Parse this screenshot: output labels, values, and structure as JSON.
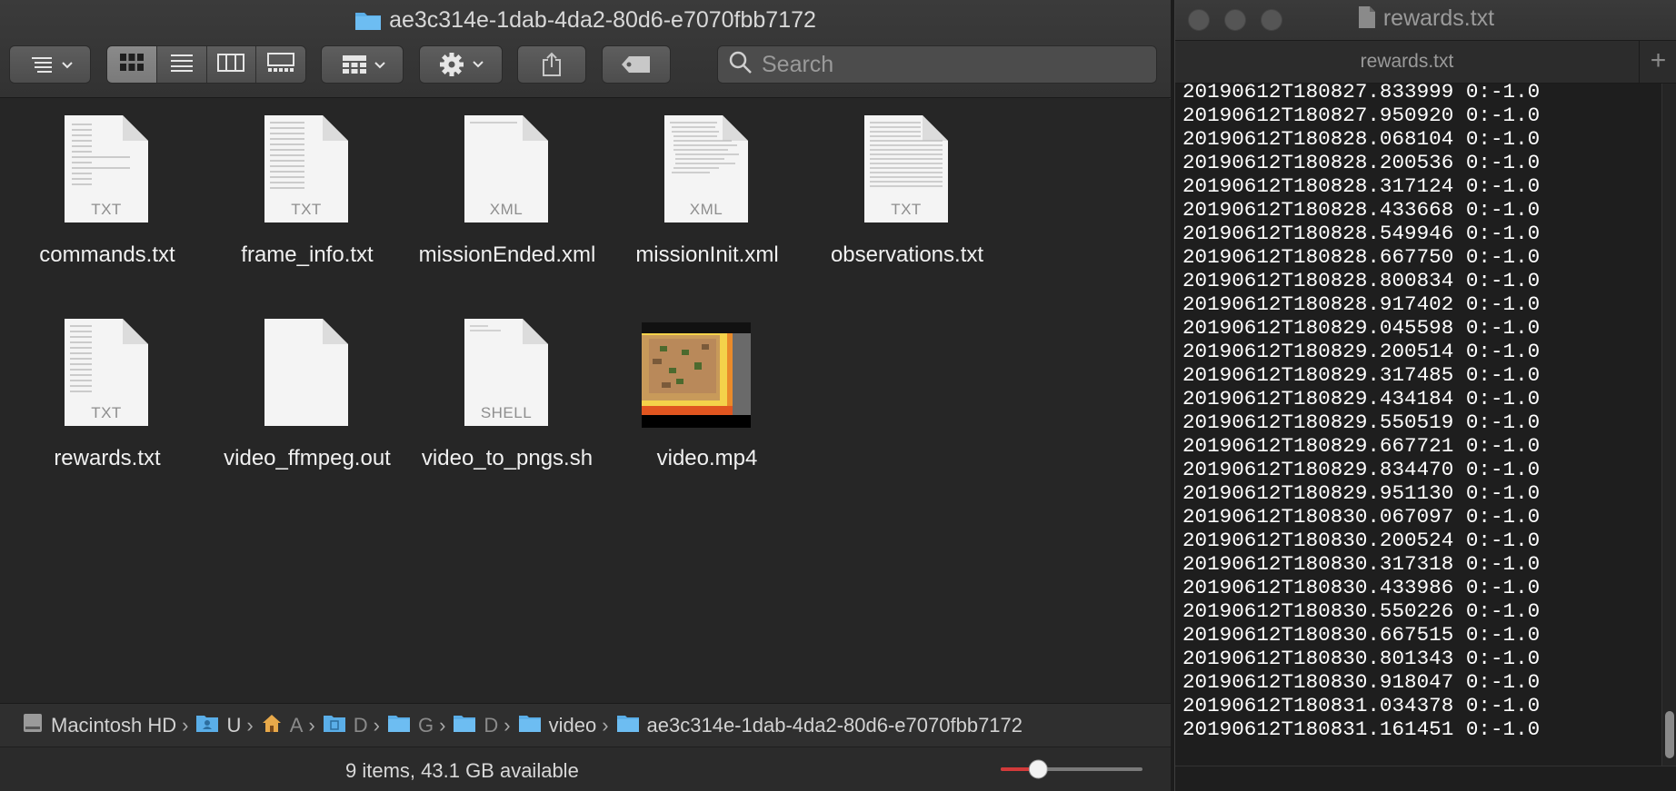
{
  "finder": {
    "title": "ae3c314e-1dab-4da2-80d6-e7070fbb7172",
    "search_placeholder": "Search",
    "files": [
      {
        "name": "commands.txt",
        "type": "TXT"
      },
      {
        "name": "frame_info.txt",
        "type": "TXT"
      },
      {
        "name": "missionEnded.xml",
        "type": "XML"
      },
      {
        "name": "missionInit.xml",
        "type": "XML"
      },
      {
        "name": "observations.txt",
        "type": "TXT"
      },
      {
        "name": "rewards.txt",
        "type": "TXT"
      },
      {
        "name": "video_ffmpeg.out",
        "type": ""
      },
      {
        "name": "video_to_pngs.sh",
        "type": "SHELL"
      },
      {
        "name": "video.mp4",
        "type": ""
      }
    ],
    "path": [
      {
        "label": "Macintosh HD",
        "icon": "hard-drive-icon"
      },
      {
        "label": "U",
        "icon": "users-folder-icon"
      },
      {
        "label": "A",
        "icon": "home-icon"
      },
      {
        "label": "D",
        "icon": "documents-folder-icon"
      },
      {
        "label": "G",
        "icon": "folder-icon"
      },
      {
        "label": "D",
        "icon": "folder-icon"
      },
      {
        "label": "video",
        "icon": "folder-icon"
      },
      {
        "label": "ae3c314e-1dab-4da2-80d6-e7070fbb7172",
        "icon": "folder-icon"
      }
    ],
    "status": "9 items, 43.1 GB available",
    "zoom_level": 0.23,
    "accent_color": "#5aaee8"
  },
  "textedit": {
    "title": "rewards.txt",
    "tab": "rewards.txt",
    "add_tab_label": "+",
    "lines": [
      "20190612T180827.833999 0:-1.0",
      "20190612T180827.950920 0:-1.0",
      "20190612T180828.068104 0:-1.0",
      "20190612T180828.200536 0:-1.0",
      "20190612T180828.317124 0:-1.0",
      "20190612T180828.433668 0:-1.0",
      "20190612T180828.549946 0:-1.0",
      "20190612T180828.667750 0:-1.0",
      "20190612T180828.800834 0:-1.0",
      "20190612T180828.917402 0:-1.0",
      "20190612T180829.045598 0:-1.0",
      "20190612T180829.200514 0:-1.0",
      "20190612T180829.317485 0:-1.0",
      "20190612T180829.434184 0:-1.0",
      "20190612T180829.550519 0:-1.0",
      "20190612T180829.667721 0:-1.0",
      "20190612T180829.834470 0:-1.0",
      "20190612T180829.951130 0:-1.0",
      "20190612T180830.067097 0:-1.0",
      "20190612T180830.200524 0:-1.0",
      "20190612T180830.317318 0:-1.0",
      "20190612T180830.433986 0:-1.0",
      "20190612T180830.550226 0:-1.0",
      "20190612T180830.667515 0:-1.0",
      "20190612T180830.801343 0:-1.0",
      "20190612T180830.918047 0:-1.0",
      "20190612T180831.034378 0:-1.0",
      "20190612T180831.161451 0:-1.0"
    ]
  }
}
